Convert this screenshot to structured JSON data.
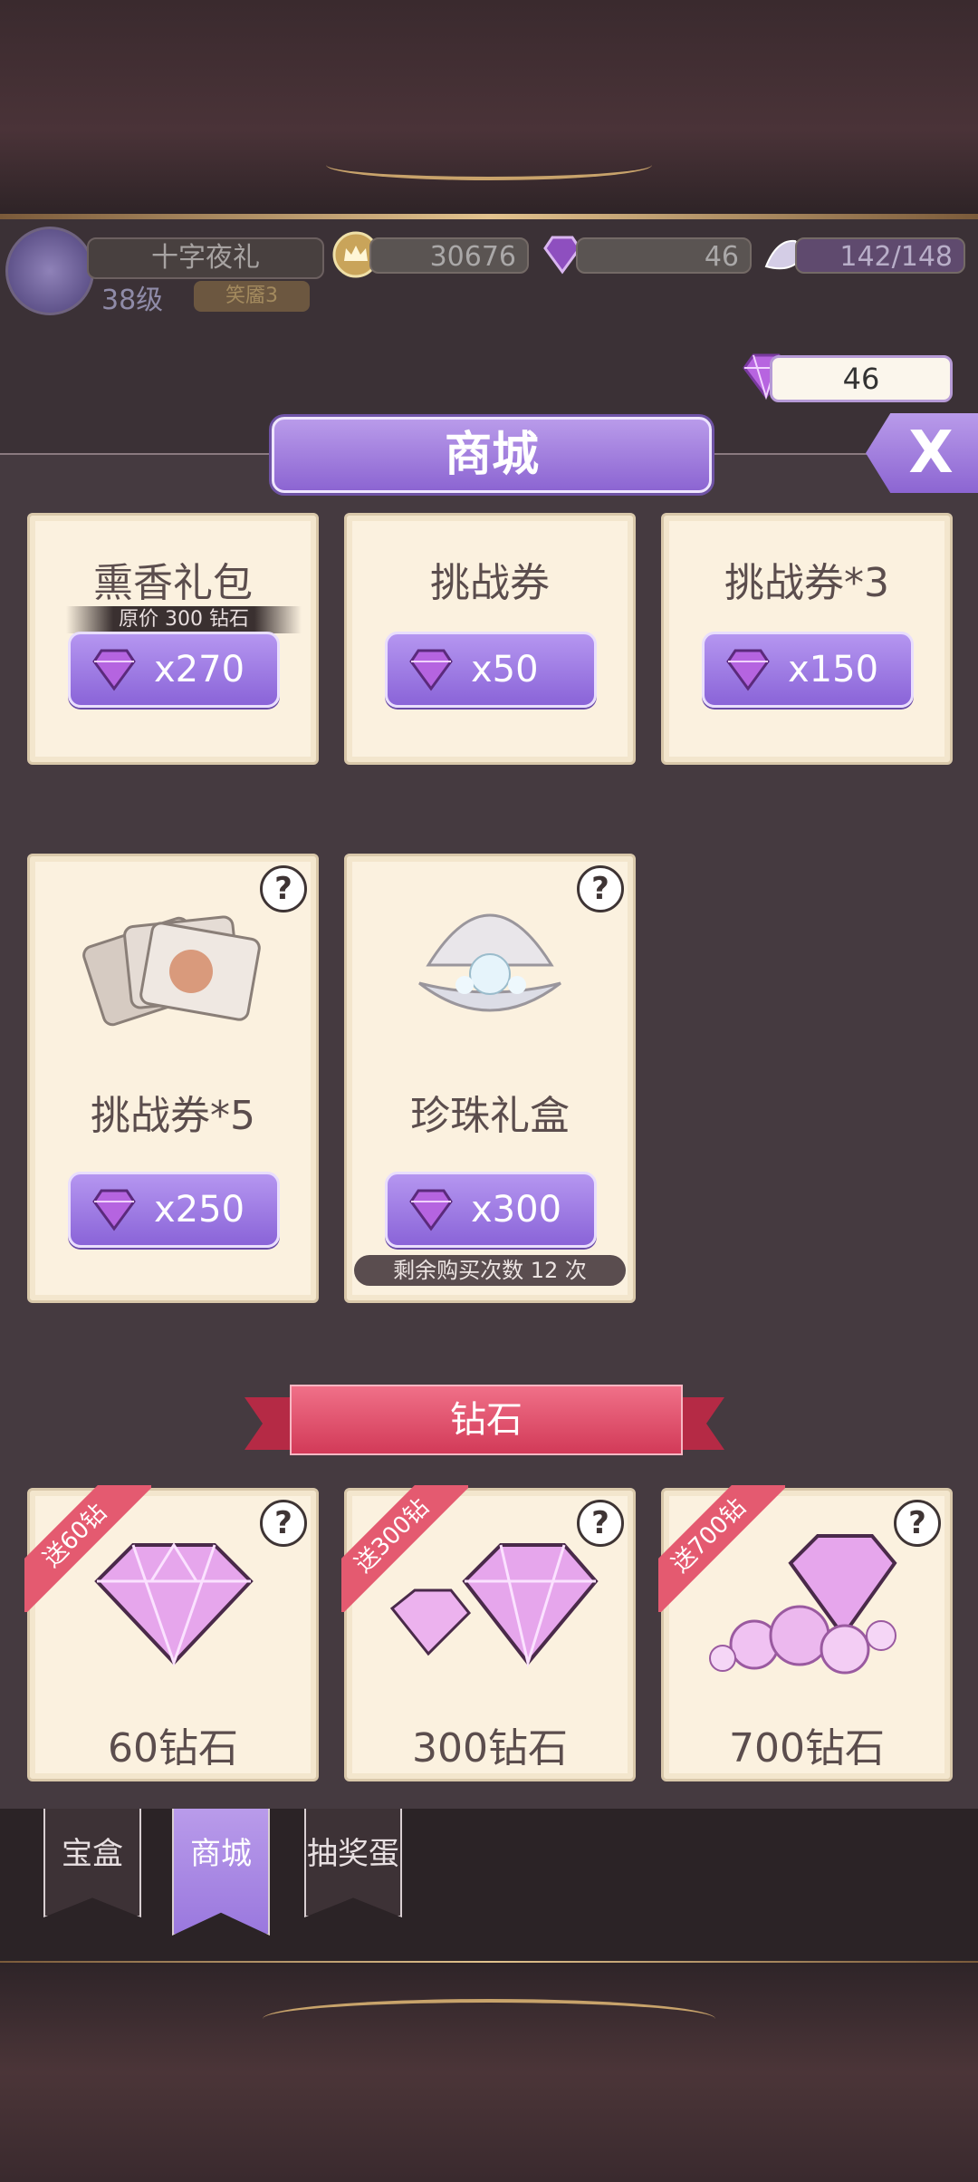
{
  "header": {
    "player_name": "十字夜礼",
    "level": "38级",
    "badge": "笑靥3",
    "gold": "30676",
    "diamonds": "46",
    "stamina": "142/148"
  },
  "diamond_balance": "46",
  "shop": {
    "title": "商城",
    "close_label": "X",
    "items": [
      {
        "name": "熏香礼包",
        "price": "x270",
        "original": "原价 300 钻石"
      },
      {
        "name": "挑战券",
        "price": "x50"
      },
      {
        "name": "挑战券*3",
        "price": "x150"
      },
      {
        "name": "挑战券*5",
        "price": "x250"
      },
      {
        "name": "珍珠礼盒",
        "price": "x300",
        "remaining": "剩余购买次数 12 次"
      }
    ],
    "diamond_section_title": "钻石",
    "diamond_packs": [
      {
        "bonus": "送60钻",
        "label": "60钻石"
      },
      {
        "bonus": "送300钻",
        "label": "300钻石"
      },
      {
        "bonus": "送700钻",
        "label": "700钻石"
      }
    ]
  },
  "tabs": [
    {
      "label": "宝盒",
      "active": false
    },
    {
      "label": "商城",
      "active": true
    },
    {
      "label": "抽奖蛋",
      "active": false
    }
  ],
  "colors": {
    "accent": "#9a78de",
    "ribbon": "#d23a58",
    "card": "#fbf1df"
  }
}
